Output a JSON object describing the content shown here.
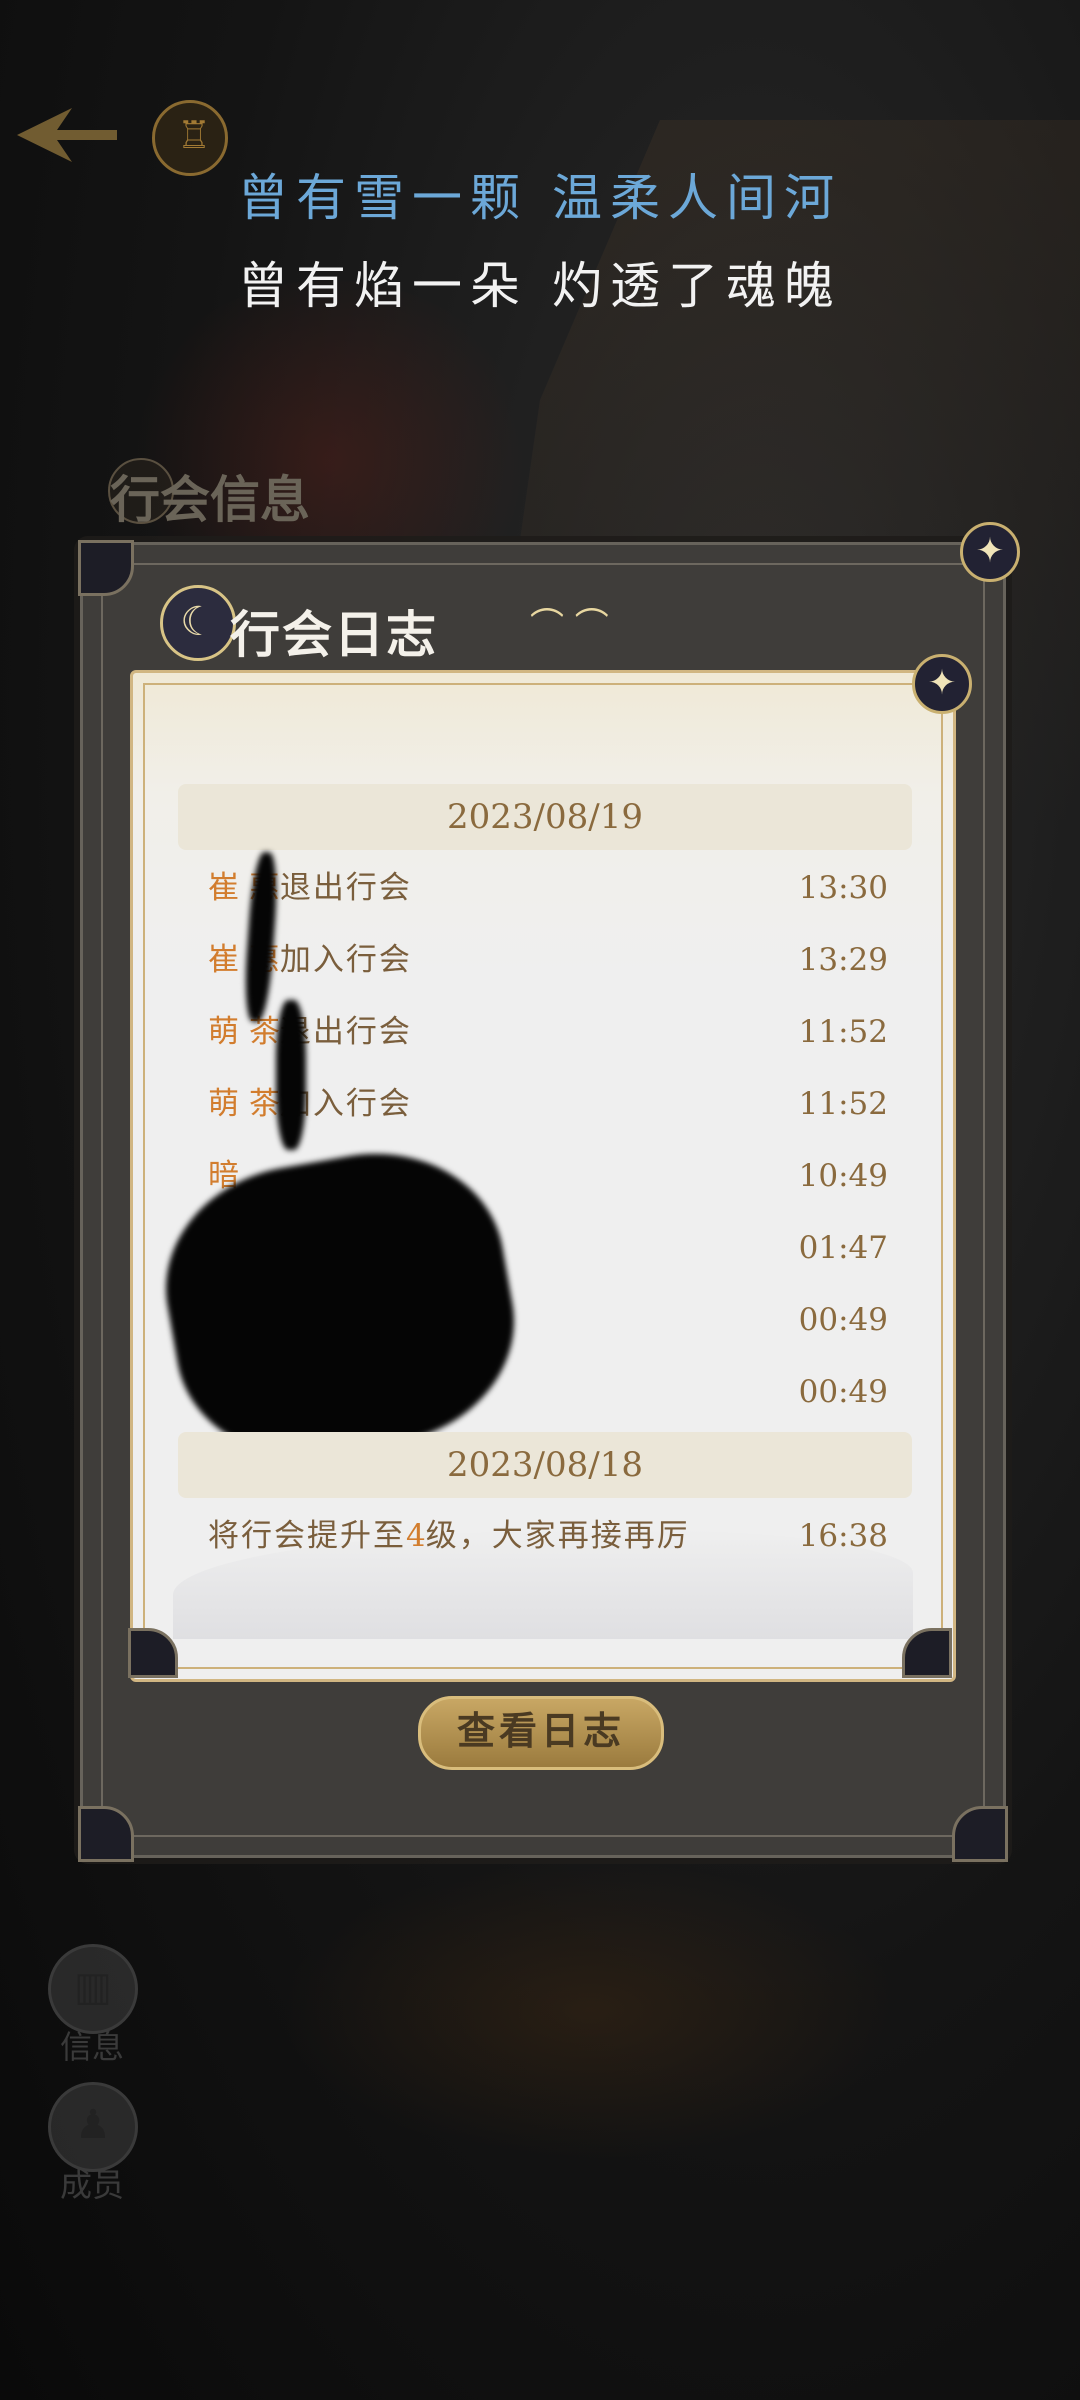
{
  "poem": {
    "line1": "曾有雪一颗 温柔人间河",
    "line2": "曾有焰一朵 灼透了魂魄"
  },
  "background_panel": {
    "title": "行会信息"
  },
  "log_panel": {
    "title": "行会日志",
    "groups": [
      {
        "date": "2023/08/19",
        "entries": [
          {
            "name": "崔 惠",
            "action": "退出行会",
            "time": "13:30"
          },
          {
            "name": "崔 惠",
            "action": "加入行会",
            "time": "13:29"
          },
          {
            "name": "萌 茶",
            "action": "退出行会",
            "time": "11:52"
          },
          {
            "name": "萌 茶",
            "action": "加入行会",
            "time": "11:52"
          },
          {
            "name": "暗",
            "action": "",
            "time": "10:49"
          },
          {
            "name": "",
            "action": "",
            "time": "01:47"
          },
          {
            "name": "",
            "action": "",
            "time": "00:49"
          },
          {
            "name": "",
            "action": "",
            "time": "00:49"
          }
        ]
      },
      {
        "date": "2023/08/18",
        "entries": [
          {
            "text_before": "将行会提升至",
            "level": "4",
            "text_after": "级，大家再接再厉",
            "time": "16:38"
          }
        ]
      }
    ],
    "view_log_button": "查看日志"
  },
  "side_nav": {
    "info_label": "信息",
    "members_label": "成员"
  },
  "icons": {
    "back": "back-arrow-icon",
    "emblem": "guild-emblem-icon",
    "close": "close-star-icon",
    "title": "moon-ornament-icon",
    "info": "building-icon",
    "members": "person-icon"
  },
  "colors": {
    "name_orange": "#d27d2e",
    "text_brown": "#7a5e3c",
    "poem_blue": "#6ca8d8",
    "gold": "#c9b070"
  }
}
